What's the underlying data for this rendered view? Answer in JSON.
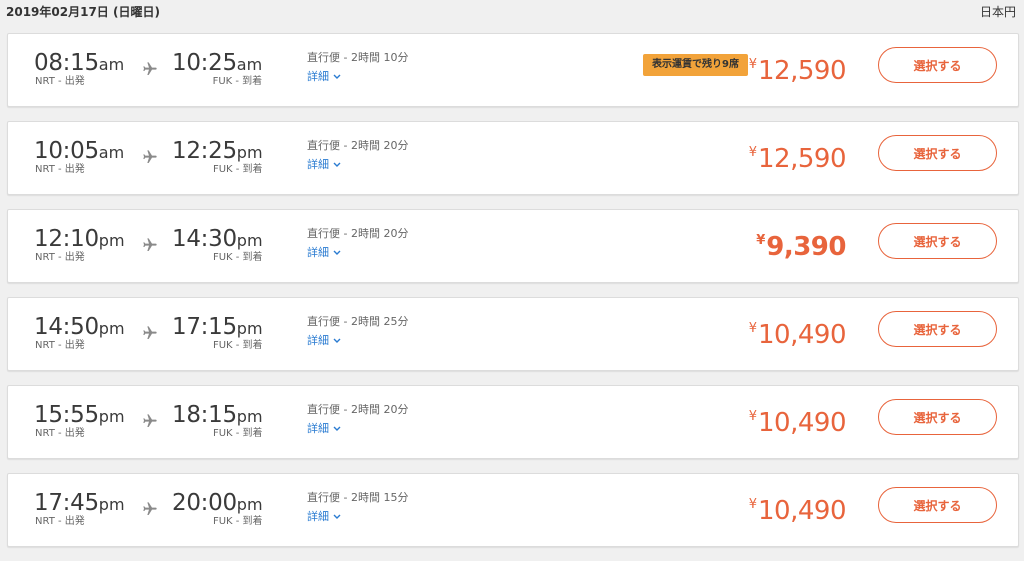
{
  "header": {
    "date": "2019年02月17日 (日曜日)",
    "currency": "日本円"
  },
  "colors": {
    "accent": "#e8643c",
    "badge": "#f2a33a",
    "link": "#2a7bd1"
  },
  "flights": [
    {
      "dep_time": "08:15",
      "dep_ampm": "am",
      "dep_airport": "NRT - 出発",
      "arr_time": "10:25",
      "arr_ampm": "am",
      "arr_airport": "FUK - 到着",
      "duration": "直行便 - 2時間 10分",
      "details": "詳細",
      "badge": "表示運賃で残り9席",
      "currency_symbol": "¥",
      "price": "12,590",
      "select": "選択する"
    },
    {
      "dep_time": "10:05",
      "dep_ampm": "am",
      "dep_airport": "NRT - 出発",
      "arr_time": "12:25",
      "arr_ampm": "pm",
      "arr_airport": "FUK - 到着",
      "duration": "直行便 - 2時間 20分",
      "details": "詳細",
      "badge": "",
      "currency_symbol": "¥",
      "price": "12,590",
      "select": "選択する"
    },
    {
      "dep_time": "12:10",
      "dep_ampm": "pm",
      "dep_airport": "NRT - 出発",
      "arr_time": "14:30",
      "arr_ampm": "pm",
      "arr_airport": "FUK - 到着",
      "duration": "直行便 - 2時間 20分",
      "details": "詳細",
      "badge": "",
      "currency_symbol": "¥",
      "price": "9,390",
      "select": "選択する"
    },
    {
      "dep_time": "14:50",
      "dep_ampm": "pm",
      "dep_airport": "NRT - 出発",
      "arr_time": "17:15",
      "arr_ampm": "pm",
      "arr_airport": "FUK - 到着",
      "duration": "直行便 - 2時間 25分",
      "details": "詳細",
      "badge": "",
      "currency_symbol": "¥",
      "price": "10,490",
      "select": "選択する"
    },
    {
      "dep_time": "15:55",
      "dep_ampm": "pm",
      "dep_airport": "NRT - 出発",
      "arr_time": "18:15",
      "arr_ampm": "pm",
      "arr_airport": "FUK - 到着",
      "duration": "直行便 - 2時間 20分",
      "details": "詳細",
      "badge": "",
      "currency_symbol": "¥",
      "price": "10,490",
      "select": "選択する"
    },
    {
      "dep_time": "17:45",
      "dep_ampm": "pm",
      "dep_airport": "NRT - 出発",
      "arr_time": "20:00",
      "arr_ampm": "pm",
      "arr_airport": "FUK - 到着",
      "duration": "直行便 - 2時間 15分",
      "details": "詳細",
      "badge": "",
      "currency_symbol": "¥",
      "price": "10,490",
      "select": "選択する"
    }
  ]
}
